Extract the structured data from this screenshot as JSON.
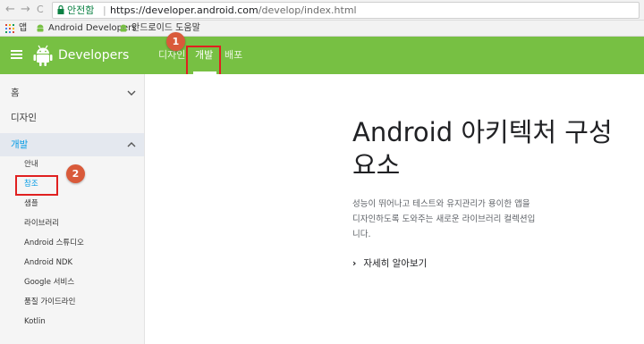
{
  "browser": {
    "back_glyph": "←",
    "forward_glyph": "→",
    "reload_glyph": "C",
    "secure_label": "안전함",
    "url_scheme_host": "https://developer.android.com",
    "url_path": "/develop/index.html",
    "bookmarks": [
      {
        "label": "앱",
        "icon": "apps-icon"
      },
      {
        "label": "Android Developers",
        "icon": "android-icon"
      },
      {
        "label": "안드로이드 도움말",
        "icon": "android-icon"
      }
    ]
  },
  "site": {
    "brand": "Developers",
    "tabs": [
      {
        "label": "디자인",
        "active": false
      },
      {
        "label": "개발",
        "active": true
      },
      {
        "label": "배포",
        "active": false
      }
    ]
  },
  "sidebar": {
    "sections": [
      {
        "label": "홈",
        "chevron": "down"
      },
      {
        "label": "디자인",
        "chevron": ""
      },
      {
        "label": "개발",
        "chevron": "up"
      }
    ],
    "sub_items": [
      {
        "label": "안내"
      },
      {
        "label": "참조"
      },
      {
        "label": "샘플"
      },
      {
        "label": "라이브러리"
      },
      {
        "label": "Android 스튜디오"
      },
      {
        "label": "Android NDK"
      },
      {
        "label": "Google 서비스"
      },
      {
        "label": "품질 가이드라인"
      },
      {
        "label": "Kotlin"
      }
    ]
  },
  "main": {
    "title_line1": "Android 아키텍처 구성",
    "title_line2": "요소",
    "desc_line1": "성능이 뛰어나고 테스트와 유지관리가 용이한 앱을",
    "desc_line2": "디자인하도록 도와주는 새로운 라이브러리 컬렉션입",
    "desc_line3": "니다.",
    "learn_more": "자세히 알아보기"
  },
  "annotations": {
    "step1": "1",
    "step2": "2"
  },
  "colors": {
    "header_green": "#77c043",
    "accent_blue": "#039be5",
    "annotation_red": "#e02020",
    "annotation_circle": "#d95a3a"
  }
}
